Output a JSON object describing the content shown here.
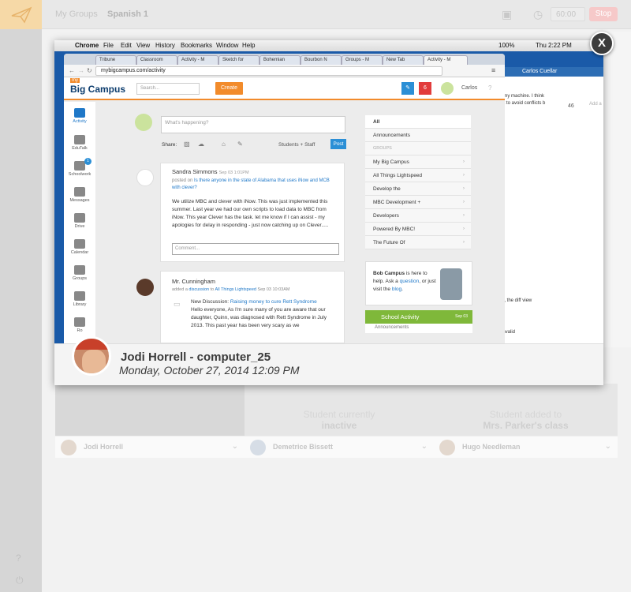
{
  "header": {
    "breadcrumb_groups": "My Groups",
    "breadcrumb_current": "Spanish 1",
    "timer": "60:00",
    "stop_label": "Stop"
  },
  "overlay": {
    "mac_menu": [
      "Chrome",
      "File",
      "Edit",
      "View",
      "History",
      "Bookmarks",
      "Window",
      "Help"
    ],
    "mac_status": "100%",
    "mac_time": "Thu 2:22 PM",
    "tabs": [
      "Tribune",
      "Classroom",
      "Activity - M",
      "Sketch for",
      "Bohemian",
      "Bourbon N",
      "Groups - M",
      "New Tab",
      "Activity - M"
    ],
    "url": "mybigcampus.com/activity",
    "behind_user": "Carlos Cuellar",
    "behind_count": "46",
    "behind_text_1": "on my machine. I think",
    "behind_text_2": "port to avoid conflicts b",
    "behind_text_3": "wer, the diff view",
    "behind_text_4": "is invalid",
    "behind_add": "Add a",
    "app": {
      "logo_small": "my",
      "logo": "Big Campus",
      "search_placeholder": "Search...",
      "create": "Create",
      "notif_count": "6",
      "user": "Carlos",
      "nav": [
        "Activity",
        "EduTalk",
        "Schoolwork",
        "Messages",
        "Drive",
        "Calendar",
        "Groups",
        "Library",
        "Ro"
      ],
      "schoolwork_badge": "1",
      "compose_placeholder": "What's happening?",
      "share_label": "Share:",
      "audience": "Students + Staff",
      "post": "Post",
      "post1": {
        "author": "Sandra Simmons",
        "time": "Sep 03 1:01PM",
        "posted_on": "posted on",
        "link": "Is there anyone in the state of Alabama that uses iNow and MCB with clever?",
        "body": "We utilize MBC and clever with iNow. This was just implemented this summer. Last year we had our own scripts to load data to MBC from iNow. This year Clever has the task. let me know if I can assist - my apologies for delay in responding - just now catching up on Clever.....",
        "comment_placeholder": "Comment..."
      },
      "post2": {
        "author": "Mr. Cunningham",
        "added": "added a",
        "discussion": "discussion",
        "to": "to",
        "group": "All Things Lightspeed",
        "time": "Sep 03 10:03AM",
        "nd_label": "New Discussion:",
        "nd_title": "Raising money to cure Rett Syndrome",
        "body": "Hello everyone, As I'm sure many of you are aware that our daughter, Quinn, was diagnosed with Rett Syndrome in July 2013. This past year has been very scary as we"
      },
      "side": {
        "all": "All",
        "announcements": "Announcements",
        "groups_heading": "GROUPS",
        "groups": [
          "My Big Campus",
          "All Things Lightspeed",
          "Develop the",
          "MBC Development +",
          "Developers",
          "Powered By MBC!",
          "The Future Of"
        ]
      },
      "bob": {
        "name": "Bob Campus",
        "text1": " is here to help. Ask a",
        "link1": "question",
        "text2": ", or just visit the",
        "link2": "blog",
        "text3": "."
      },
      "school_activity": "School Activity",
      "school_date": "Sep 03",
      "school_announcements": "Announcements"
    },
    "student_name": "Jodi Horrell - computer_25",
    "timestamp": "Monday, October 27, 2014 12:09 PM"
  },
  "close_label": "X",
  "cards": [
    {
      "name": "Jodi Horrell",
      "msg1": "",
      "msg2": ""
    },
    {
      "name": "Demetrice Bissett",
      "msg1": "Student currently",
      "msg2": "inactive"
    },
    {
      "name": "Hugo Needleman",
      "msg1": "Student added to",
      "msg2": "Mrs. Parker's class"
    }
  ]
}
